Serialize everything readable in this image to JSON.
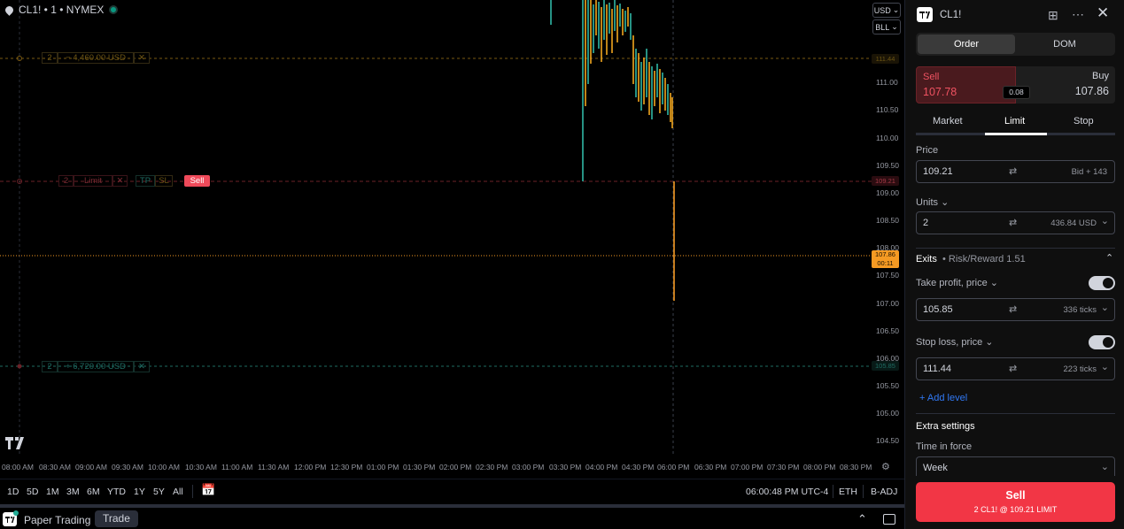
{
  "chart": {
    "symbol": "CL1! • 1 • NYMEX",
    "currency_button": "USD",
    "unit_button": "BLL",
    "y_ticks": [
      "111.00",
      "110.50",
      "110.00",
      "109.50",
      "109.00",
      "108.50",
      "108.00",
      "107.50",
      "107.00",
      "106.50",
      "106.00",
      "105.50",
      "105.00",
      "104.50"
    ],
    "x_ticks": [
      "08:00 AM",
      "08:30 AM",
      "09:00 AM",
      "09:30 AM",
      "10:00 AM",
      "10:30 AM",
      "11:00 AM",
      "11:30 AM",
      "12:00 PM",
      "12:30 PM",
      "01:00 PM",
      "01:30 PM",
      "02:00 PM",
      "02:30 PM",
      "03:00 PM",
      "03:30 PM",
      "04:00 PM",
      "04:30 PM",
      "05:00 PM",
      "06:00 PM",
      "06:30 PM",
      "07:00 PM",
      "07:30 PM",
      "08:00 PM",
      "08:30 PM"
    ],
    "stop_line": {
      "qty": "2",
      "pnl": "− 4,460.00 USD",
      "close": "✕",
      "price": "111.44"
    },
    "limit_line": {
      "qty": "2",
      "type": "Limit",
      "close": "✕",
      "tp": "TP",
      "sl": "SL",
      "side": "Sell",
      "price": "109.21"
    },
    "tp_line": {
      "qty": "2",
      "pnl": "+ 6,720.00 USD",
      "close": "✕",
      "price": "105.85"
    },
    "last_price": {
      "price": "107.86",
      "countdown": "00:11"
    },
    "colors": {
      "up": "#f0a51e",
      "down": "#2fb8a6",
      "stop": "#7a5a12",
      "limit": "#ef4a5a",
      "tp": "#1e6b62",
      "last": "#f59a23"
    }
  },
  "range_bar": {
    "ranges": [
      "1D",
      "5D",
      "1M",
      "3M",
      "6M",
      "YTD",
      "1Y",
      "5Y",
      "All"
    ],
    "clock": "06:00:48 PM UTC-4",
    "session": "ETH",
    "adjust": "B-ADJ"
  },
  "bottom_bar": {
    "broker": "Paper Trading",
    "tab": "Trade"
  },
  "panel": {
    "title": "CL1!",
    "mode_tabs": [
      "Order",
      "DOM"
    ],
    "sell": {
      "label": "Sell",
      "price": "107.78"
    },
    "buy": {
      "label": "Buy",
      "price": "107.86"
    },
    "spread": "0.08",
    "order_types": [
      "Market",
      "Limit",
      "Stop"
    ],
    "price_label": "Price",
    "price_value": "109.21",
    "price_aux": "Bid + 143",
    "units_label": "Units",
    "units_value": "2",
    "units_aux": "436.84 USD",
    "exits_label": "Exits",
    "risk_reward": "• Risk/Reward 1.51",
    "tp_label": "Take profit, price",
    "tp_value": "105.85",
    "tp_aux": "336 ticks",
    "sl_label": "Stop loss, price",
    "sl_value": "111.44",
    "sl_aux": "223 ticks",
    "add_level": "Add level",
    "extra_settings": "Extra settings",
    "tif_label": "Time in force",
    "tif_value": "Week",
    "submit_title": "Sell",
    "submit_detail": "2 CL1! @ 109.21 LIMIT"
  }
}
